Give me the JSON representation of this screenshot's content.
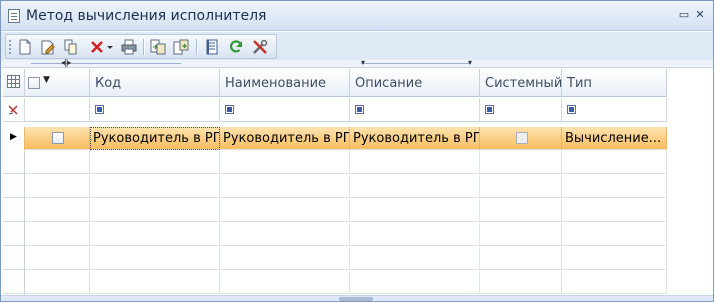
{
  "window": {
    "title": "Метод вычисления исполнителя",
    "controls": [
      "▭",
      "✕"
    ]
  },
  "toolbar": {
    "icons": [
      "new-doc-icon",
      "edit-icon",
      "copy-icon",
      "delete-icon",
      "dropdown-arrow-icon",
      "print-icon",
      "import-icon",
      "export-icon",
      "list-icon",
      "refresh-icon",
      "settings-tools-icon"
    ]
  },
  "grid": {
    "columns": [
      {
        "key": "select",
        "label": ""
      },
      {
        "key": "code",
        "label": "Код"
      },
      {
        "key": "name",
        "label": "Наименование"
      },
      {
        "key": "description",
        "label": "Описание"
      },
      {
        "key": "system",
        "label": "Системный"
      },
      {
        "key": "type",
        "label": "Тип"
      }
    ],
    "rows": [
      {
        "code": "Руководитель в РП",
        "name": "Руководитель в РП",
        "description": "Руководитель в РП",
        "system": false,
        "type": "Вычисление..."
      }
    ],
    "empty_rows": 6
  },
  "colors": {
    "selected_row": "#f8bc5e",
    "title_text": "#1b2f4e",
    "header_text": "#3d4d63"
  }
}
